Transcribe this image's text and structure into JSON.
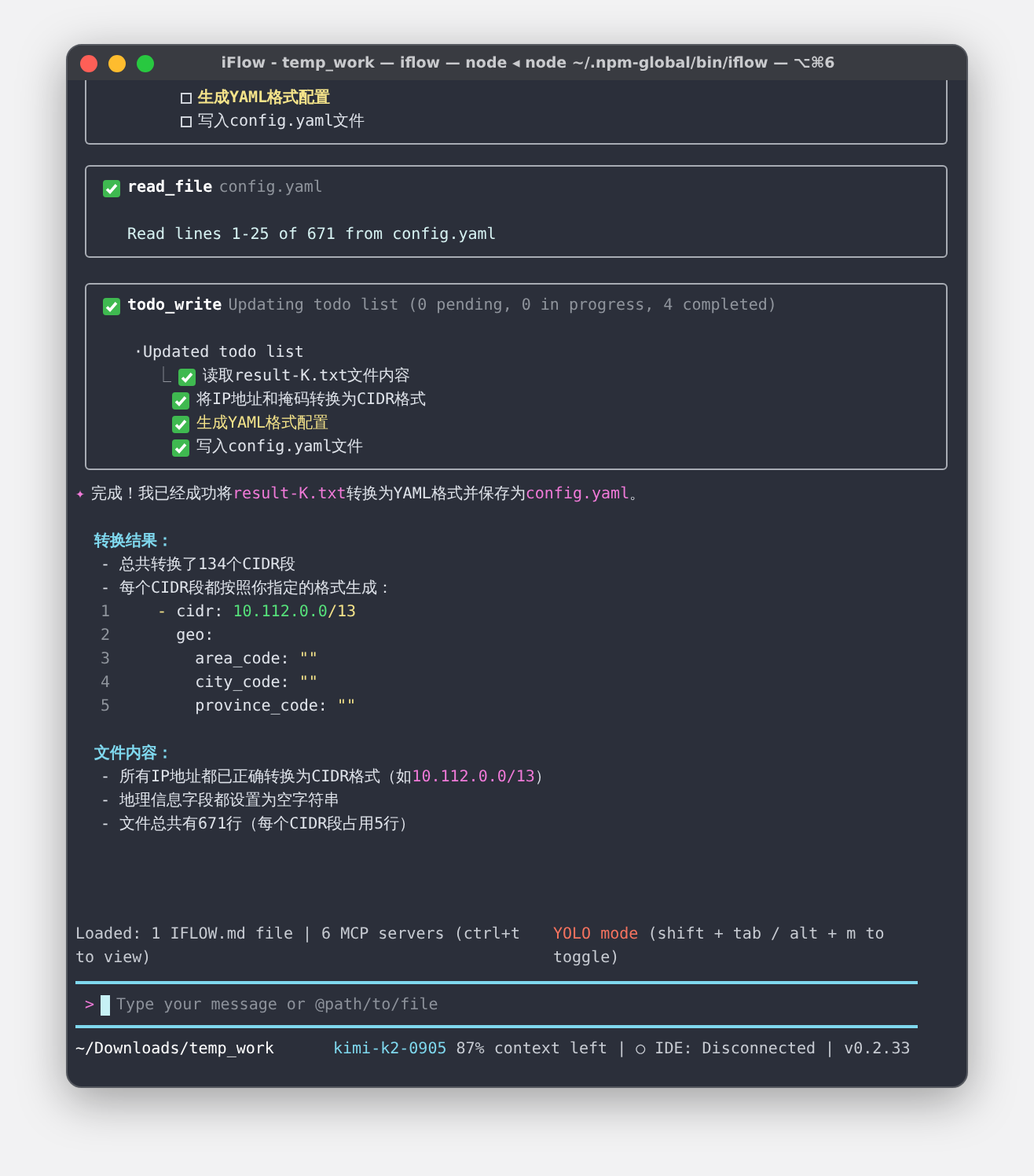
{
  "window": {
    "title": "iFlow - temp_work — iflow — node ◂ node ~/.npm-global/bin/iflow — ⌥⌘6"
  },
  "top_card": {
    "items": [
      {
        "text": "生成YAML格式配置",
        "checked": false,
        "current": true
      },
      {
        "text": "写入config.yaml文件",
        "checked": false,
        "current": false
      }
    ]
  },
  "read_card": {
    "tool": "read_file",
    "args": "config.yaml",
    "output": "Read lines 1-25 of 671 from config.yaml"
  },
  "todo_card": {
    "tool": "todo_write",
    "args": "Updating todo list (0 pending, 0 in progress, 4 completed)",
    "list_title": "·Updated todo list",
    "branch": "⎿",
    "items": [
      {
        "text": "读取result-K.txt文件内容",
        "checked": true,
        "current": false
      },
      {
        "text": "将IP地址和掩码转换为CIDR格式",
        "checked": true,
        "current": false
      },
      {
        "text": "生成YAML格式配置",
        "checked": true,
        "current": true
      },
      {
        "text": "写入config.yaml文件",
        "checked": true,
        "current": false
      }
    ]
  },
  "message": {
    "prefix": "✦",
    "segments": [
      {
        "kind": "plain",
        "text": "完成！我已经成功将"
      },
      {
        "kind": "code",
        "text": "result-K.txt"
      },
      {
        "kind": "plain",
        "text": "转换为YAML格式并保存为"
      },
      {
        "kind": "code",
        "text": "config.yaml"
      },
      {
        "kind": "plain",
        "text": "。"
      }
    ]
  },
  "sections": [
    {
      "heading": "转换结果：",
      "lines": [
        {
          "kind": "bullet",
          "segments": [
            {
              "kind": "plain",
              "text": "- 总共转换了134个CIDR段"
            }
          ]
        },
        {
          "kind": "bullet",
          "segments": [
            {
              "kind": "plain",
              "text": "- 每个CIDR段都按照你指定的格式生成："
            }
          ]
        },
        {
          "kind": "code",
          "number": "1",
          "segments": [
            {
              "kind": "dash",
              "text": "  - "
            },
            {
              "kind": "plain",
              "text": "cidr: "
            },
            {
              "kind": "green",
              "text": "10.112.0.0"
            },
            {
              "kind": "yellow",
              "text": "/13"
            }
          ]
        },
        {
          "kind": "code",
          "number": "2",
          "segments": [
            {
              "kind": "plain",
              "text": "    geo:"
            }
          ]
        },
        {
          "kind": "code",
          "number": "3",
          "segments": [
            {
              "kind": "plain",
              "text": "      area_code: "
            },
            {
              "kind": "yellow",
              "text": "\"\""
            }
          ]
        },
        {
          "kind": "code",
          "number": "4",
          "segments": [
            {
              "kind": "plain",
              "text": "      city_code: "
            },
            {
              "kind": "yellow",
              "text": "\"\""
            }
          ]
        },
        {
          "kind": "code",
          "number": "5",
          "segments": [
            {
              "kind": "plain",
              "text": "      province_code: "
            },
            {
              "kind": "yellow",
              "text": "\"\""
            }
          ]
        }
      ]
    },
    {
      "heading": "文件内容：",
      "lines": [
        {
          "kind": "bullet",
          "segments": [
            {
              "kind": "plain",
              "text": "- 所有IP地址都已正确转换为CIDR格式（如"
            },
            {
              "kind": "code",
              "text": "10.112.0.0/13"
            },
            {
              "kind": "plain",
              "text": "）"
            }
          ]
        },
        {
          "kind": "bullet",
          "segments": [
            {
              "kind": "plain",
              "text": "- 地理信息字段都设置为空字符串"
            }
          ]
        },
        {
          "kind": "bullet",
          "segments": [
            {
              "kind": "plain",
              "text": "- 文件总共有671行（每个CIDR段占用5行）"
            }
          ]
        }
      ]
    }
  ],
  "footer": {
    "loaded": "Loaded: 1 IFLOW.md file | 6 MCP servers (ctrl+t to view)",
    "mode": "YOLO mode",
    "mode_hint": "(shift + tab / alt + m to toggle)"
  },
  "input": {
    "prompt": ">",
    "placeholder": "Type your message or @path/to/file"
  },
  "status_bar": {
    "path": "~/Downloads/temp_work",
    "model": "kimi-k2-0905",
    "info": "87% context left | ○ IDE: Disconnected | v0.2.33"
  }
}
